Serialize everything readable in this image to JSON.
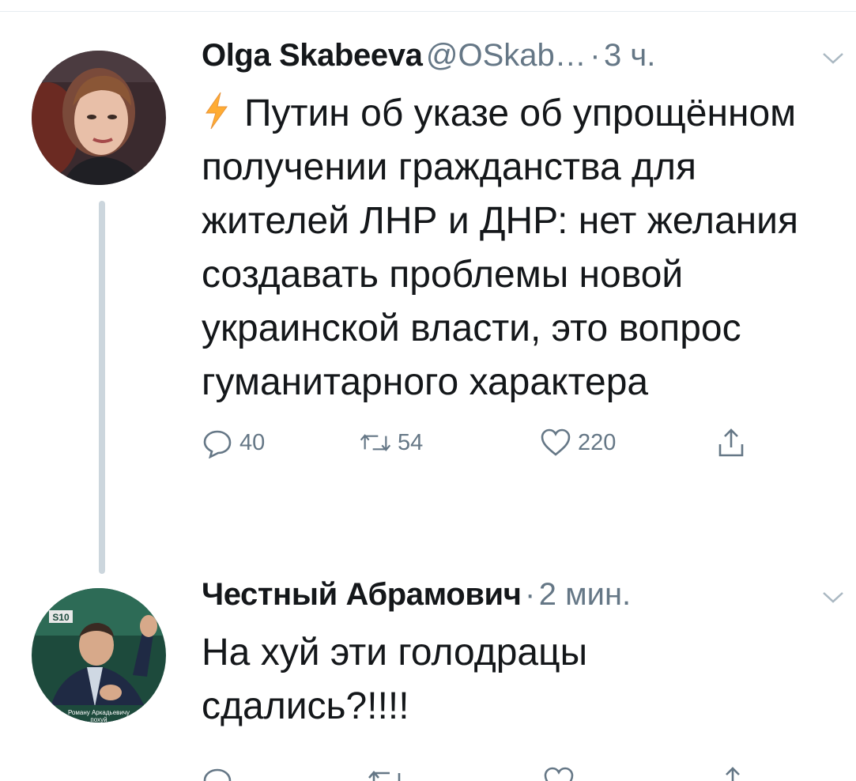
{
  "tweets": [
    {
      "author": "Olga Skabeeva",
      "handle": "@OSkab…",
      "separator": "·",
      "time": "3 ч.",
      "text": "Путин об указе об упрощённом получении гражданства для жителей ЛНР и ДНР: нет желания создавать проблемы новой украинской власти, это вопрос гуманитарного характера",
      "actions": {
        "replies": "40",
        "retweets": "54",
        "likes": "220"
      }
    },
    {
      "author": "Честный Абрамович",
      "separator": "·",
      "time": "2 мин.",
      "text": "На хуй эти голодрацы сдались?!!!!"
    }
  ],
  "avatar2_caption": {
    "top": "S10",
    "bottom1": "Роману Аркадьевичу",
    "bottom2": "похуй"
  },
  "colors": {
    "text": "#14171a",
    "muted": "#657786",
    "thread_line": "#ccd6dd",
    "bolt": "#ffac33"
  },
  "icons": [
    "lightning-icon",
    "reply-icon",
    "retweet-icon",
    "like-icon",
    "share-icon",
    "chevron-down-icon"
  ]
}
